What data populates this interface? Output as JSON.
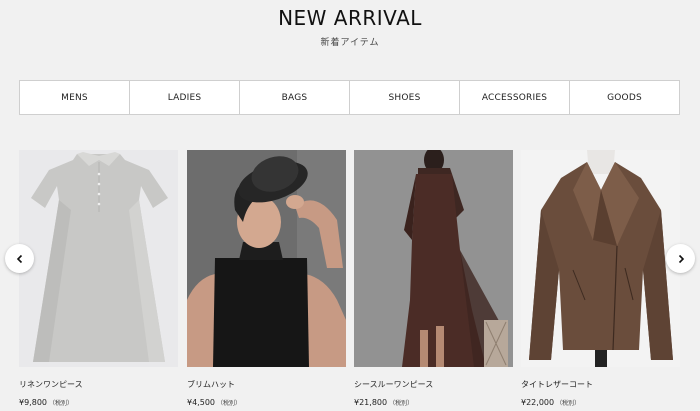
{
  "header": {
    "title": "NEW ARRIVAL",
    "subtitle": "新着アイテム"
  },
  "categories": [
    "MENS",
    "LADIES",
    "BAGS",
    "SHOES",
    "ACCESSORIES",
    "GOODS"
  ],
  "products": [
    {
      "name": "リネンワンピース",
      "price": "¥9,800",
      "tax": "（税別）"
    },
    {
      "name": "ブリムハット",
      "price": "¥4,500",
      "tax": "（税別）"
    },
    {
      "name": "シースルーワンピース",
      "price": "¥21,800",
      "tax": "（税別）"
    },
    {
      "name": "タイトレザーコート",
      "price": "¥22,000",
      "tax": "（税別）"
    }
  ],
  "carousel": {
    "prev_icon": "chevron-left-icon",
    "next_icon": "chevron-right-icon"
  },
  "colors": {
    "background": "#f1f1f1",
    "nav_background": "#ffffff",
    "border": "#cfcfcf",
    "text": "#222222"
  }
}
